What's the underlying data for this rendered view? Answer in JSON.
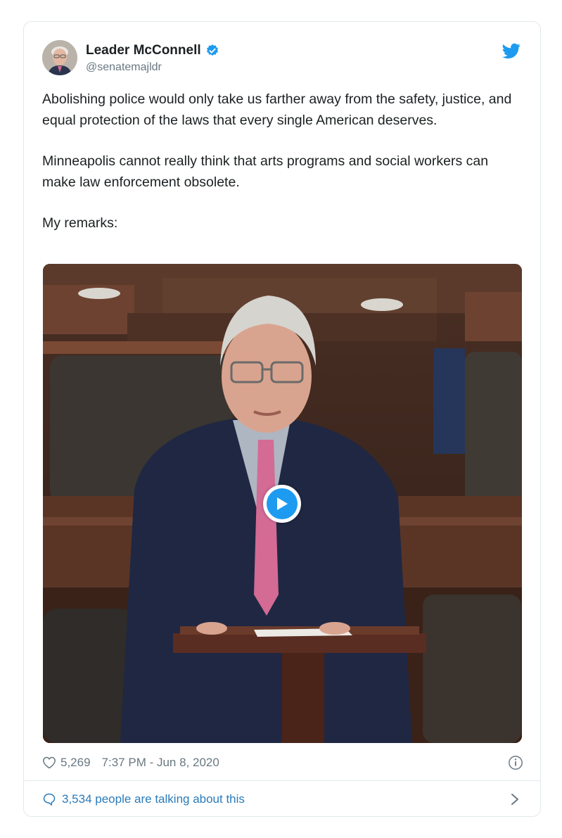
{
  "author": {
    "display_name": "Leader McConnell",
    "handle": "@senatemajldr",
    "verified": true,
    "avatar_icon": "person-avatar"
  },
  "tweet": {
    "paragraphs": [
      "Abolishing police would only take us farther away from the safety, justice, and equal protection of the laws that every single American deserves.",
      "Minneapolis cannot really think that arts programs and social workers can make law enforcement obsolete.",
      "My remarks:"
    ]
  },
  "media": {
    "type": "video",
    "play_icon": "play-icon"
  },
  "meta": {
    "like_count": "5,269",
    "timestamp": "7:37 PM - Jun 8, 2020"
  },
  "conversation": {
    "label": "3,534 people are talking about this"
  },
  "colors": {
    "accent": "#1d9bf0",
    "link": "#2b7bb9",
    "muted": "#697882",
    "border": "#e1e8ed"
  }
}
